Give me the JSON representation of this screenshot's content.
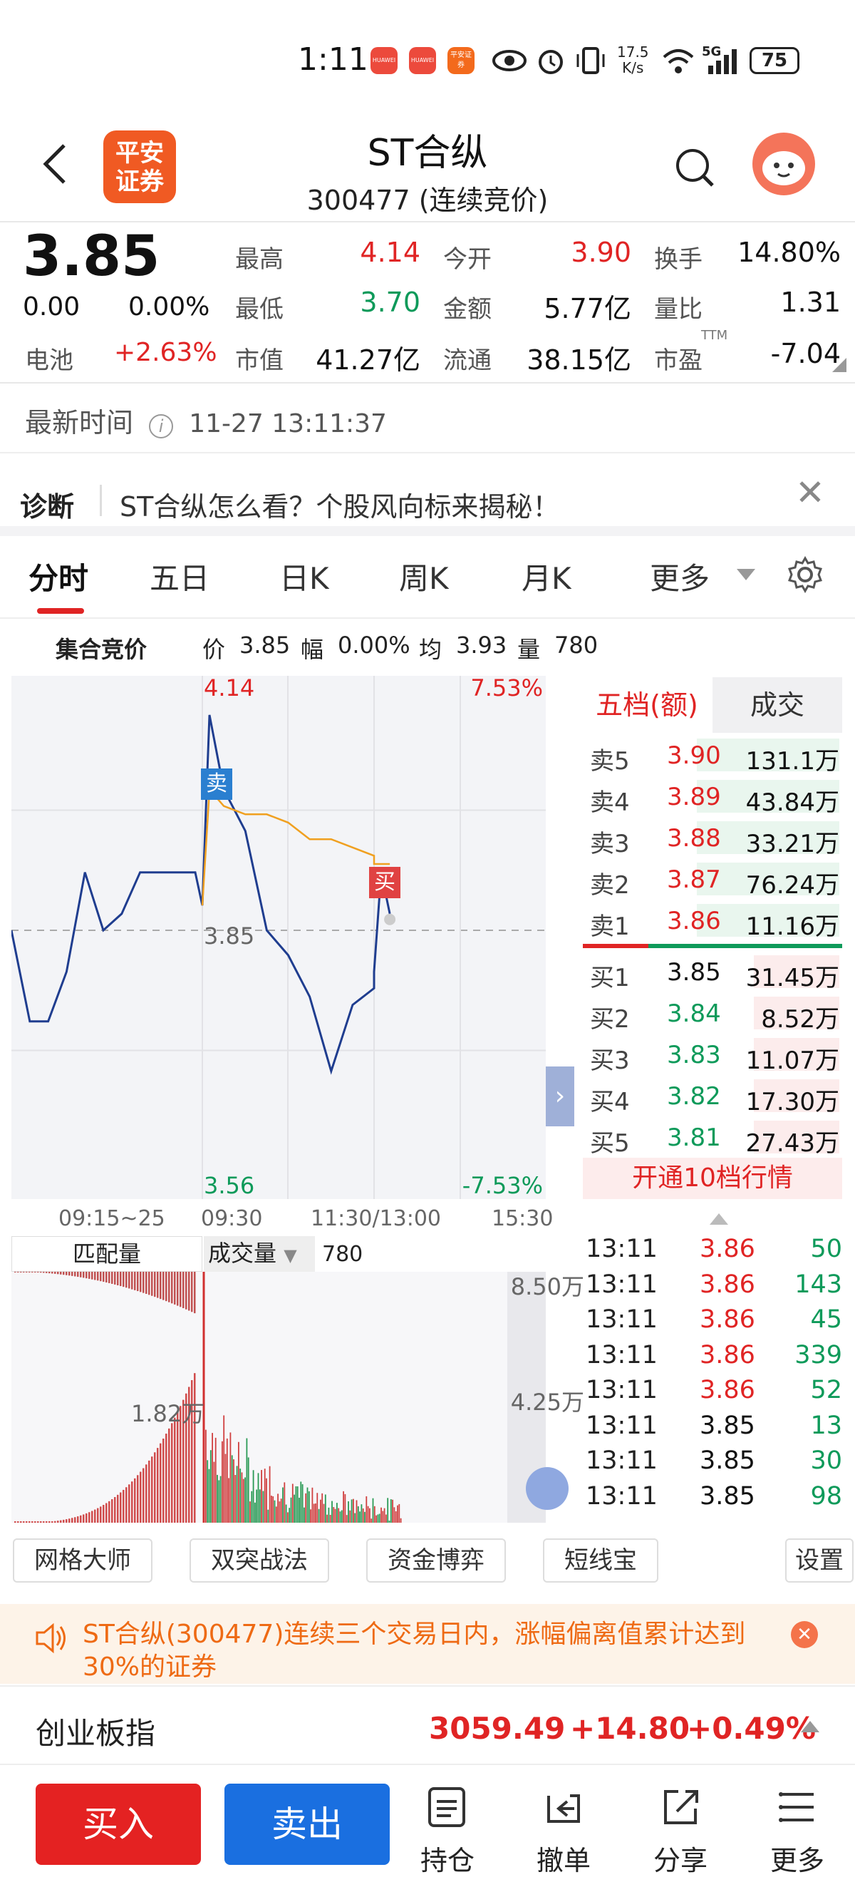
{
  "status_bar": {
    "time": "1:11",
    "apps": [
      "HUAWEI",
      "HUAWEI",
      "平安证券"
    ],
    "net_speed_value": "17.5",
    "net_speed_unit": "K/s",
    "network": "5G",
    "battery": "75"
  },
  "header": {
    "logo_text_1": "平安",
    "logo_text_2": "证券",
    "stock_name": "ST合纵",
    "stock_code_line": "300477 (连续竞价)"
  },
  "quote": {
    "price": "3.85",
    "change": "0.00",
    "change_pct": "0.00%",
    "sector_label": "电池",
    "sector_pct": "+2.63%",
    "high_label": "最高",
    "high": "4.14",
    "open_label": "今开",
    "open": "3.90",
    "turnover_label": "换手",
    "turnover": "14.80%",
    "low_label": "最低",
    "low": "3.70",
    "amount_label": "金额",
    "amount": "5.77亿",
    "vol_ratio_label": "量比",
    "vol_ratio": "1.31",
    "mcap_label": "市值",
    "mcap": "41.27亿",
    "float_label": "流通",
    "float": "38.15亿",
    "pe_label": "市盈",
    "pe_sup": "TTM",
    "pe": "-7.04"
  },
  "latest_time": {
    "label": "最新时间",
    "value": "11-27 13:11:37"
  },
  "diagnosis": {
    "label": "诊断",
    "text": "ST合纵怎么看？个股风向标来揭秘！"
  },
  "tabs": [
    "分时",
    "五日",
    "日K",
    "周K",
    "月K",
    "更多"
  ],
  "info_bar": {
    "mode": "集合竞价",
    "price_label": "价",
    "price": "3.85",
    "range_label": "幅",
    "range": "0.00%",
    "avg_label": "均",
    "avg": "3.93",
    "vol_label": "量",
    "vol": "780"
  },
  "chart_data": {
    "type": "line",
    "title": "",
    "x_ticks": [
      "09:15~25",
      "09:30",
      "11:30/13:00",
      "15:30"
    ],
    "ylim": [
      3.56,
      4.14
    ],
    "y_left_labels": {
      "top": "4.14",
      "mid": "3.85",
      "bottom": "3.56"
    },
    "y_right_labels": {
      "top": "7.53%",
      "bottom": "-7.53%"
    },
    "markers": [
      {
        "label": "卖",
        "time": "09:30",
        "price": 4.02
      },
      {
        "label": "买",
        "time": "13:11",
        "price": 3.92
      }
    ],
    "series": [
      {
        "name": "",
        "x": [
          "09:15",
          "09:16",
          "09:17",
          "09:18",
          "09:19",
          "09:20",
          "09:21",
          "09:22",
          "09:23",
          "09:24",
          "09:25",
          "09:30",
          "09:35",
          "09:45",
          "10:00",
          "10:15",
          "10:30",
          "10:45",
          "11:00",
          "11:15",
          "11:30",
          "13:00",
          "13:05",
          "13:11"
        ],
        "values": [
          3.85,
          3.74,
          3.74,
          3.8,
          3.92,
          3.85,
          3.87,
          3.92,
          3.92,
          3.92,
          3.92,
          3.88,
          4.11,
          4.02,
          3.97,
          3.85,
          3.82,
          3.77,
          3.68,
          3.76,
          3.78,
          3.8,
          3.92,
          3.87
        ]
      },
      {
        "name": "",
        "x": [
          "09:30",
          "09:35",
          "09:45",
          "10:00",
          "10:15",
          "10:30",
          "10:45",
          "11:00",
          "11:15",
          "11:30",
          "13:00",
          "13:11"
        ],
        "values": [
          3.88,
          4.02,
          4.0,
          3.99,
          3.99,
          3.98,
          3.96,
          3.96,
          3.95,
          3.94,
          3.93,
          3.93
        ]
      }
    ],
    "volume": {
      "tab_left": "匹配量",
      "tab_right": "成交量",
      "value": "780",
      "max_label": "8.50万",
      "mid_label": "4.25万",
      "auction_label": "1.82万"
    }
  },
  "order_book": {
    "tab_left": "五档(额)",
    "tab_right": "成交",
    "asks": [
      {
        "label": "卖5",
        "price": "3.90",
        "amount": "131.1万"
      },
      {
        "label": "卖4",
        "price": "3.89",
        "amount": "43.84万"
      },
      {
        "label": "卖3",
        "price": "3.88",
        "amount": "33.21万"
      },
      {
        "label": "卖2",
        "price": "3.87",
        "amount": "76.24万"
      },
      {
        "label": "卖1",
        "price": "3.86",
        "amount": "11.16万"
      }
    ],
    "bids": [
      {
        "label": "买1",
        "price": "3.85",
        "amount": "31.45万"
      },
      {
        "label": "买2",
        "price": "3.84",
        "amount": "8.52万"
      },
      {
        "label": "买3",
        "price": "3.83",
        "amount": "11.07万"
      },
      {
        "label": "买4",
        "price": "3.82",
        "amount": "17.30万"
      },
      {
        "label": "买5",
        "price": "3.81",
        "amount": "27.43万"
      }
    ],
    "upgrade_text": "开通10档行情"
  },
  "ticks": [
    {
      "time": "13:11",
      "price": "3.86",
      "vol": "50"
    },
    {
      "time": "13:11",
      "price": "3.86",
      "vol": "143"
    },
    {
      "time": "13:11",
      "price": "3.86",
      "vol": "45"
    },
    {
      "time": "13:11",
      "price": "3.86",
      "vol": "339"
    },
    {
      "time": "13:11",
      "price": "3.86",
      "vol": "52"
    },
    {
      "time": "13:11",
      "price": "3.85",
      "vol": "13"
    },
    {
      "time": "13:11",
      "price": "3.85",
      "vol": "30"
    },
    {
      "time": "13:11",
      "price": "3.85",
      "vol": "98"
    }
  ],
  "tools": [
    "网格大师",
    "双突战法",
    "资金博弈",
    "短线宝",
    "设置"
  ],
  "notice": {
    "text": "ST合纵(300477)连续三个交易日内，涨幅偏离值累计达到30%的证券"
  },
  "index": {
    "name": "创业板指",
    "value": "3059.49",
    "change": "+14.80",
    "change_pct": "+0.49%"
  },
  "bottom_nav": {
    "buy": "买入",
    "sell": "卖出",
    "items": [
      "持仓",
      "撤单",
      "分享",
      "更多"
    ]
  }
}
